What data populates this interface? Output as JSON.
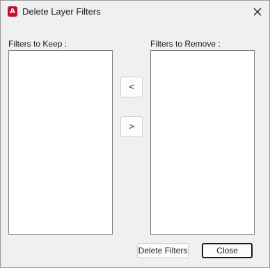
{
  "window": {
    "title": "Delete Layer Filters",
    "app_icon_letter": "A"
  },
  "keep": {
    "label": "Filters to Keep :",
    "items": []
  },
  "remove": {
    "label": "Filters to Remove :",
    "items": []
  },
  "move_buttons": {
    "move_left_label": "<",
    "move_right_label": ">"
  },
  "footer": {
    "delete_label": "Delete Filters",
    "close_label": "Close"
  },
  "icons": {
    "app": "autocad-icon",
    "close": "close-icon"
  },
  "colors": {
    "app_icon": "#c8102e",
    "dialog_background": "#f0f0f0",
    "list_background": "#ffffff"
  }
}
